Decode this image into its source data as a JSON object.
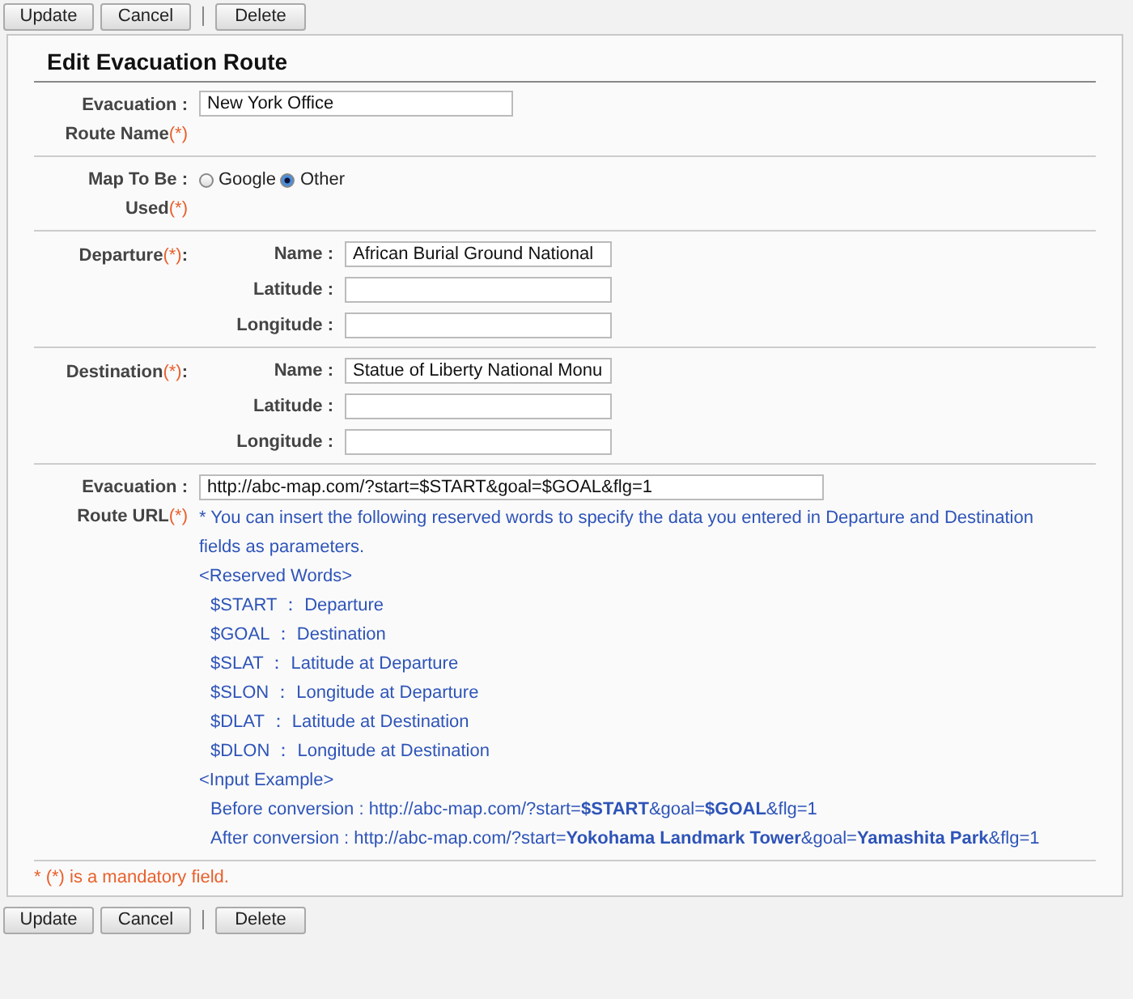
{
  "toolbar_top": [
    {
      "label": "Update"
    },
    {
      "label": "Cancel"
    },
    {
      "label": "Delete"
    }
  ],
  "title": "Edit Evacuation Route",
  "rows": [
    {
      "kind": "text",
      "label_lines": [
        "Evacuation :",
        "Route Name"
      ],
      "mark": "(*)",
      "value": "New York Office"
    },
    {
      "kind": "radio",
      "label_lines": [
        "Map To Be :",
        "Used"
      ],
      "mark": "(*)",
      "options": [
        {
          "label": "Google",
          "selected": false
        },
        {
          "label": "Other",
          "selected": true
        }
      ]
    },
    {
      "kind": "place",
      "label": "Departure",
      "mark": "(*)",
      "suffix": ":",
      "fields": [
        {
          "label": "Name :",
          "value": "African Burial Ground National"
        },
        {
          "label": "Latitude :"
        },
        {
          "label": "Longitude :"
        }
      ]
    },
    {
      "kind": "place",
      "label": "Destination",
      "mark": "(*)",
      "suffix": ":",
      "fields": [
        {
          "label": "Name :",
          "value": "Statue of Liberty National Monu"
        },
        {
          "label": "Latitude :"
        },
        {
          "label": "Longitude :"
        }
      ]
    },
    {
      "kind": "url",
      "label_lines": [
        "Evacuation :",
        "Route URL"
      ],
      "mark": "(*)",
      "value": "http://abc-map.com/?start=$START&goal=$GOAL&flg=1",
      "help": [
        {
          "kind": "note",
          "text": "* You can insert the following reserved words to specify the data you entered in Departure and Destination fields as parameters."
        },
        {
          "kind": "heading",
          "text": "<Reserved Words>"
        },
        {
          "kind": "item",
          "text": "$START ： Departure"
        },
        {
          "kind": "item",
          "text": "$GOAL ： Destination"
        },
        {
          "kind": "item",
          "text": "$SLAT ： Latitude at Departure"
        },
        {
          "kind": "item",
          "text": "$SLON ： Longitude at Departure"
        },
        {
          "kind": "item",
          "text": "$DLAT ： Latitude at Destination"
        },
        {
          "kind": "item",
          "text": "$DLON ： Longitude at Destination"
        },
        {
          "kind": "heading",
          "text": "<Input Example>"
        },
        {
          "kind": "item",
          "text": "Before conversion : http://abc-map.com/?start=**$START**&goal=**$GOAL**&flg=1"
        },
        {
          "kind": "item",
          "text": "After conversion : http://abc-map.com/?start=**Yokohama Landmark Tower**&goal=**Yamashita Park**&flg=1"
        }
      ]
    }
  ],
  "footnote": "* (*) is a mandatory field.",
  "toolbar_bottom": [
    {
      "label": "Update"
    },
    {
      "label": "Cancel"
    },
    {
      "label": "Delete"
    }
  ]
}
